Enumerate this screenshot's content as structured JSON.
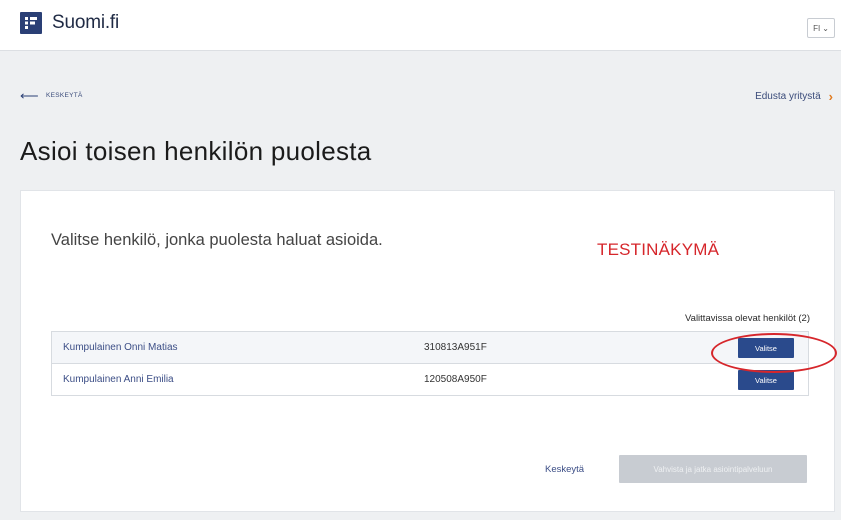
{
  "header": {
    "logo_text": "Suomi.fi",
    "language": "FI"
  },
  "nav": {
    "back_label": "KESKEYTÄ",
    "represent_company_label": "Edusta yritystä"
  },
  "page": {
    "title": "Asioi toisen henkilön puolesta"
  },
  "card": {
    "lead": "Valitse henkilö, jonka puolesta haluat asioida.",
    "test_label": "TESTINÄKYMÄ",
    "count_label": "Valittavissa olevat henkilöt (2)",
    "persons": [
      {
        "name": "Kumpulainen Onni Matias",
        "id": "310813A951F",
        "button": "Valitse"
      },
      {
        "name": "Kumpulainen Anni Emilia",
        "id": "120508A950F",
        "button": "Valitse"
      }
    ],
    "cancel_label": "Keskeytä",
    "confirm_label": "Vahvista ja jatka asiointipalveluun"
  },
  "colors": {
    "brand": "#2a3f75",
    "button": "#2a4a8c",
    "test_label": "#d6262b",
    "accent_chevron": "#e07a1f"
  }
}
